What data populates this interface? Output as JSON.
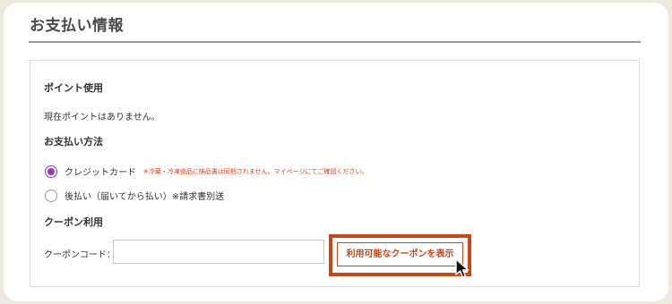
{
  "page": {
    "title": "お支払い情報"
  },
  "points": {
    "heading": "ポイント使用",
    "status": "現在ポイントはありません。"
  },
  "payment": {
    "heading": "お支払い方法",
    "options": [
      {
        "label": "クレジットカード",
        "selected": true,
        "notice": "※冷蔵・冷凍食品に納品書は同梱されません。マイページにてご確認ください。"
      },
      {
        "label": "後払い（届いてから払い）※請求書別送",
        "selected": false
      }
    ]
  },
  "coupon": {
    "heading": "クーポン利用",
    "code_label": "クーポンコード：",
    "code_value": "",
    "show_button_label": "利用可能なクーポンを表示"
  },
  "colors": {
    "accent_purple": "#8f3bbd",
    "highlight_orange": "#cc4516",
    "notice_red": "#e0401a"
  },
  "icons": [
    "radio-selected-icon",
    "radio-unselected-icon",
    "mouse-pointer-icon"
  ]
}
